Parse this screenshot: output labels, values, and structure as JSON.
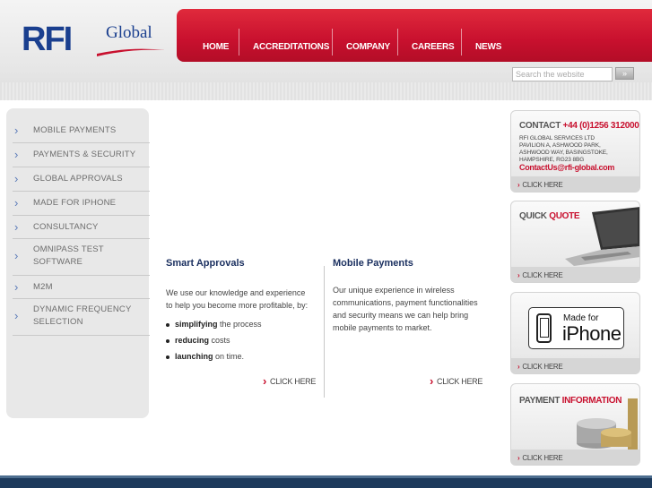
{
  "brand": {
    "name_primary": "RFI",
    "name_secondary": "Global",
    "primary_color": "#1a3f8f",
    "accent_color": "#c8102e"
  },
  "nav": {
    "items": [
      {
        "label": "HOME"
      },
      {
        "label": "ACCREDITATIONS"
      },
      {
        "label": "COMPANY"
      },
      {
        "label": "CAREERS"
      },
      {
        "label": "NEWS"
      }
    ]
  },
  "search": {
    "placeholder": "Search the website",
    "button_label": "»"
  },
  "sidebar": {
    "items": [
      {
        "label": "MOBILE PAYMENTS"
      },
      {
        "label": "PAYMENTS & SECURITY"
      },
      {
        "label": "GLOBAL APPROVALS"
      },
      {
        "label": "MADE FOR IPHONE"
      },
      {
        "label": "CONSULTANCY"
      },
      {
        "label": "OMNIPASS TEST SOFTWARE"
      },
      {
        "label": "M2M"
      },
      {
        "label": "DYNAMIC FREQUENCY SELECTION"
      }
    ]
  },
  "main": {
    "left": {
      "title": "Smart Approvals",
      "intro": "We use our knowledge and experience to help you become more profitable, by:",
      "bullets": [
        {
          "bold": "simplifying",
          "rest": " the process"
        },
        {
          "bold": "reducing",
          "rest": " costs"
        },
        {
          "bold": "launching",
          "rest": " on time."
        }
      ],
      "cta": "CLICK HERE"
    },
    "right": {
      "title": "Mobile Payments",
      "body": "Our unique experience in wireless communications, payment functionalities and security means we can help bring mobile payments to market.",
      "cta": "CLICK HERE"
    }
  },
  "panels": {
    "contact": {
      "heading": "CONTACT",
      "phone": "+44 (0)1256 312000",
      "address_lines": [
        "RFI GLOBAL SERVICES LTD",
        "PAVILION A, ASHWOOD PARK,",
        "ASHWOOD WAY, BASINGSTOKE,",
        "HAMPSHIRE, RG23 8BG"
      ],
      "email": "ContactUs@rfi-global.com",
      "cta": "CLICK HERE"
    },
    "quote": {
      "heading_a": "QUICK",
      "heading_b": "QUOTE",
      "cta": "CLICK HERE"
    },
    "iphone": {
      "made_for": "Made for",
      "word": "iPhone",
      "cta": "CLICK HERE"
    },
    "payment": {
      "heading_a": "PAYMENT",
      "heading_b": "INFORMATION",
      "cta": "CLICK HERE"
    }
  }
}
